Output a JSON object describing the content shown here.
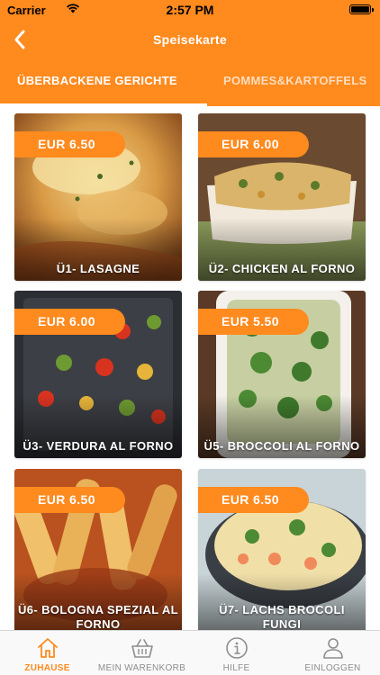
{
  "status_bar": {
    "carrier": "Carrier",
    "time": "2:57 PM"
  },
  "header": {
    "title": "Speisekarte"
  },
  "tabs": [
    {
      "label": "ÜBERBACKENE GERICHTE",
      "active": true
    },
    {
      "label": "POMMES&KARTOFFELS",
      "active": false
    }
  ],
  "menu": {
    "items": [
      {
        "name": "Ü1- LASAGNE",
        "price": "EUR  6.50"
      },
      {
        "name": "Ü2- CHICKEN AL FORNO",
        "price": "EUR  6.00"
      },
      {
        "name": "Ü3- VERDURA AL FORNO",
        "price": "EUR  6.00"
      },
      {
        "name": "Ü5- BROCCOLI AL FORNO",
        "price": "EUR  5.50"
      },
      {
        "name": "Ü6- BOLOGNA SPEZIAL AL FORNO",
        "price": "EUR  6.50"
      },
      {
        "name": "Ü7- LACHS BROCOLI FUNGI",
        "price": "EUR  6.50"
      }
    ]
  },
  "tabbar": {
    "items": [
      {
        "label": "ZUHAUSE",
        "icon": "home-icon",
        "active": true
      },
      {
        "label": "MEIN WARENKORB",
        "icon": "basket-icon",
        "active": false
      },
      {
        "label": "HILFE",
        "icon": "info-icon",
        "active": false
      },
      {
        "label": "EINLOGGEN",
        "icon": "user-icon",
        "active": false
      }
    ]
  },
  "colors": {
    "accent": "#ff8a1e",
    "tabbar_bg": "#f9f9f9",
    "inactive": "#8e8e8e"
  }
}
